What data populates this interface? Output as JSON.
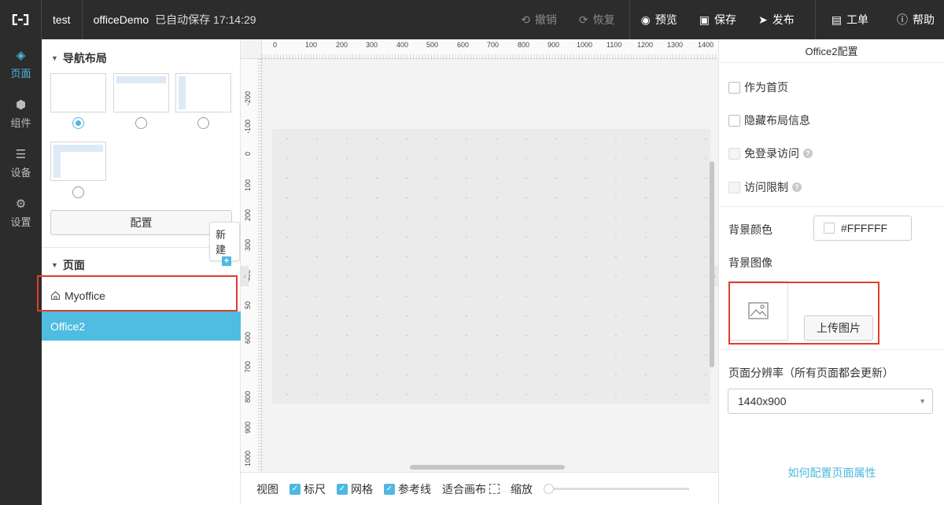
{
  "topbar": {
    "project": "test",
    "app_name": "officeDemo",
    "autosave": "已自动保存 17:14:29",
    "undo": "撤销",
    "redo": "恢复",
    "preview": "预览",
    "save": "保存",
    "publish": "发布",
    "ticket": "工单",
    "help": "帮助"
  },
  "leftnav": {
    "items": [
      {
        "label": "页面",
        "icon": "layers-icon",
        "active": true
      },
      {
        "label": "组件",
        "icon": "cube-icon",
        "active": false
      },
      {
        "label": "设备",
        "icon": "server-icon",
        "active": false
      },
      {
        "label": "设置",
        "icon": "gear-icon",
        "active": false
      }
    ]
  },
  "sidepanel": {
    "nav_layout_title": "导航布局",
    "layouts": [
      "none",
      "top-bar",
      "left-sidebar",
      "top-and-left"
    ],
    "selected_layout": 0,
    "config_button": "配置",
    "pages_title": "页面",
    "new_tooltip": "新建",
    "pages": [
      {
        "name": "Myoffice",
        "home": true,
        "active": false
      },
      {
        "name": "Office2",
        "home": false,
        "active": true
      }
    ]
  },
  "canvas": {
    "ruler_top": [
      "0",
      "100",
      "200",
      "300",
      "400",
      "500",
      "600",
      "700",
      "800",
      "900",
      "1000",
      "1100",
      "1200",
      "1300",
      "1400"
    ],
    "ruler_left": [
      "-200",
      "-100",
      "0",
      "100",
      "200",
      "300",
      "400",
      "50",
      "600",
      "700",
      "800",
      "900",
      "1000",
      "00"
    ]
  },
  "bottombar": {
    "view": "视图",
    "ruler": "标尺",
    "grid": "网格",
    "guides": "参考线",
    "fit_canvas": "适合画布",
    "zoom": "缩放"
  },
  "rightpanel": {
    "title": "Office2配置",
    "set_home": "作为首页",
    "hide_layout": "隐藏布局信息",
    "no_login": "免登录访问",
    "access_limit": "访问限制",
    "bg_color_label": "背景颜色",
    "bg_color_value": "#FFFFFF",
    "bg_image_label": "背景图像",
    "upload_button": "上传图片",
    "resolution_label": "页面分辨率（所有页面都会更新）",
    "resolution_value": "1440x900",
    "help_link": "如何配置页面属性"
  },
  "colors": {
    "accent": "#4fb8e0",
    "topbar_bg": "#2c2c2c",
    "highlight_red": "#e23b2e"
  }
}
